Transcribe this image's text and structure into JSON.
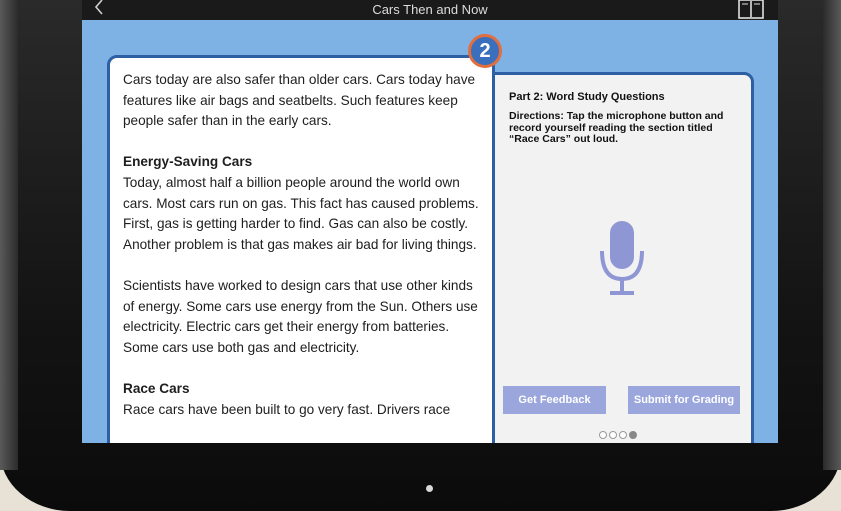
{
  "app": {
    "title": "Cars Then and Now",
    "page_number": "2"
  },
  "reading": {
    "p1": "Cars today are also safer than older cars. Cars today have features like air bags and seatbelts. Such features keep people safer than in the early cars.",
    "h1": "Energy-Saving Cars",
    "p2": "Today, almost half a billion people around the world own cars. Most cars run on gas. This fact has caused problems. First, gas is getting harder to find. Gas can also be costly. Another problem is that gas makes air bad for living things.",
    "p3": "Scientists have worked to design cars that use other kinds of energy. Some cars use energy from the Sun. Others use electricity. Electric cars get their energy from batteries. Some cars use both gas and electricity.",
    "h2": "Race Cars",
    "p4": "Race cars have been built to go very fast. Drivers race"
  },
  "question": {
    "heading": "Part 2: Word Study Questions",
    "directions": "Directions: Tap the microphone button and record yourself reading the section titled “Race Cars” out loud.",
    "feedback_button": "Get Feedback",
    "submit_button": "Submit for Grading",
    "pager": {
      "total": 4,
      "current": 4
    }
  },
  "icons": {
    "back": "chevron-left-icon",
    "book": "book-icon",
    "mic": "microphone-icon"
  },
  "colors": {
    "screen_bg": "#7eb2e4",
    "panel_border": "#2c5fa3",
    "badge_border": "#e16e3c",
    "button": "#9aa6dc",
    "mic": "#8e97d3"
  }
}
